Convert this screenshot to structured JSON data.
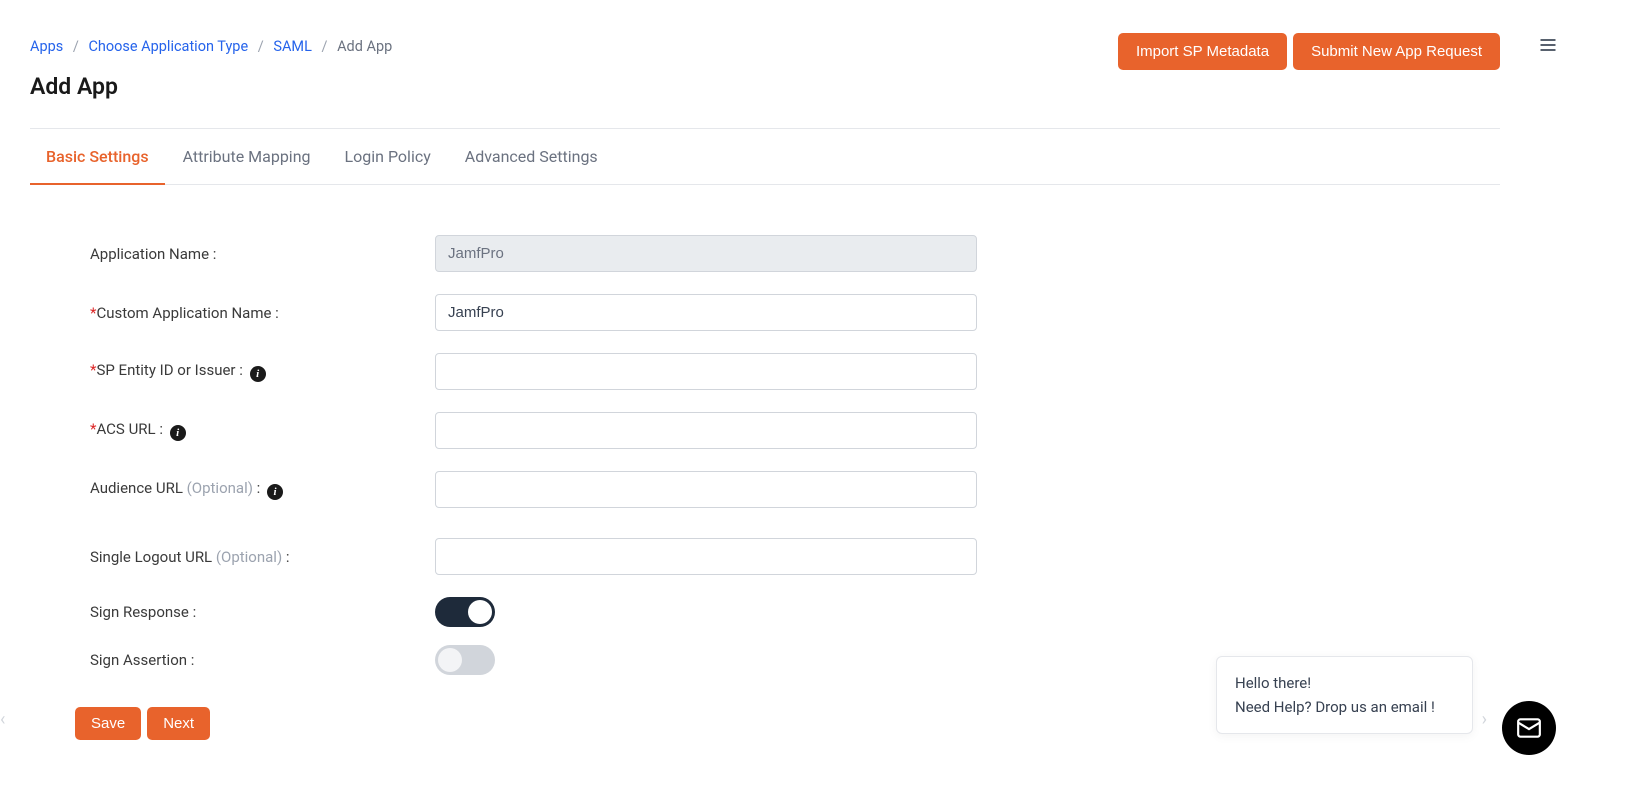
{
  "breadcrumb": {
    "items": [
      "Apps",
      "Choose Application Type",
      "SAML"
    ],
    "current": "Add App"
  },
  "page_title": "Add App",
  "header_buttons": {
    "import": "Import SP Metadata",
    "submit": "Submit New App Request"
  },
  "tabs": [
    {
      "label": "Basic Settings",
      "active": true
    },
    {
      "label": "Attribute Mapping",
      "active": false
    },
    {
      "label": "Login Policy",
      "active": false
    },
    {
      "label": "Advanced Settings",
      "active": false
    }
  ],
  "form": {
    "app_name": {
      "label": "Application Name :",
      "value": "JamfPro",
      "required": false,
      "disabled": true
    },
    "custom_app_name": {
      "label": "Custom Application Name :",
      "value": "JamfPro",
      "required": true
    },
    "sp_entity": {
      "label": "SP Entity ID or Issuer :",
      "value": "",
      "required": true,
      "info": true
    },
    "acs_url": {
      "label": "ACS URL :",
      "value": "",
      "required": true,
      "info": true
    },
    "audience_url": {
      "label": "Audience URL",
      "optional": "(Optional)",
      "suffix": " :",
      "value": "",
      "info": true
    },
    "slo_url": {
      "label": "Single Logout URL",
      "optional": "(Optional)",
      "suffix": " :",
      "value": ""
    },
    "sign_response": {
      "label": "Sign Response :",
      "on": true
    },
    "sign_assertion": {
      "label": "Sign Assertion :",
      "on": false
    }
  },
  "footer": {
    "save": "Save",
    "next": "Next"
  },
  "chat": {
    "line1": "Hello there!",
    "line2": "Need Help? Drop us an email !"
  }
}
